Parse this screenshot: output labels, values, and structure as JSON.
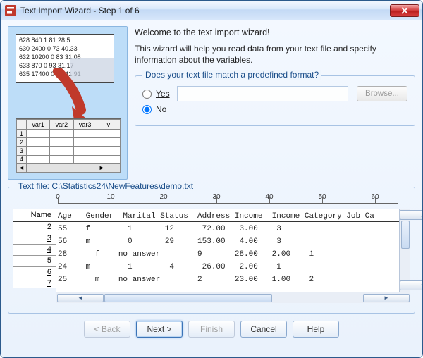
{
  "title": "Text Import Wizard - Step 1 of 6",
  "welcome": "Welcome to the text import wizard!",
  "description": "This wizard will help you read data from your text file and specify information about the variables.",
  "illus_raw": "628 840 1 81 28.5\n630 2400 0 73 40.33\n632 10200 0 83 31.08\n633 870 0 93 31.17\n635 17400 0 83 41.91",
  "illus_headers": [
    "var1",
    "var2",
    "var3",
    "v"
  ],
  "format_group": {
    "legend": "Does your text file match a predefined format?",
    "yes": "Yes",
    "no": "No",
    "browse": "Browse...",
    "selected": "no"
  },
  "preview": {
    "legend_prefix": "Text file:  ",
    "path": "C:\\Statistics24\\NewFeatures\\demo.txt",
    "ruler_ticks": [
      "0",
      "10",
      "20",
      "30",
      "40",
      "50",
      "60"
    ],
    "name_header": "Name",
    "row_numbers": [
      "2",
      "3",
      "4",
      "5",
      "6",
      "7"
    ],
    "header_line": "Age   Gender  Marital Status  Address Income  Income Category Job Ca",
    "data_lines": [
      "55    f        1       12      72.00   3.00    3",
      "56    m        0       29     153.00   4.00    3",
      "28      f    no answer        9       28.00   2.00    1",
      "24    m        1        4      26.00   2.00    1",
      "25      m    no answer        2       23.00   1.00    2",
      ""
    ]
  },
  "buttons": {
    "back": "< Back",
    "next": "Next  >",
    "finish": "Finish",
    "cancel": "Cancel",
    "help": "Help"
  }
}
